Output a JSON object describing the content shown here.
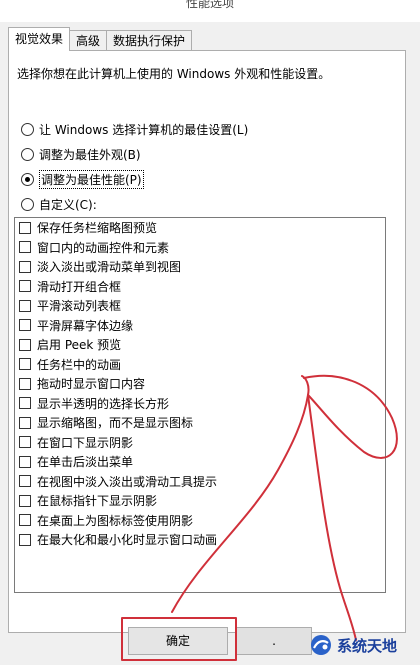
{
  "window": {
    "title": "性能选项"
  },
  "tabs": [
    {
      "label": "视觉效果",
      "active": true
    },
    {
      "label": "高级",
      "active": false
    },
    {
      "label": "数据执行保护",
      "active": false
    }
  ],
  "panel": {
    "description": "选择你想在此计算机上使用的 Windows 外观和性能设置。",
    "radios": [
      {
        "label": "让 Windows 选择计算机的最佳设置(L)",
        "checked": false
      },
      {
        "label": "调整为最佳外观(B)",
        "checked": false
      },
      {
        "label": "调整为最佳性能(P)",
        "checked": true
      },
      {
        "label": "自定义(C):",
        "checked": false
      }
    ],
    "effects": [
      "保存任务栏缩略图预览",
      "窗口内的动画控件和元素",
      "淡入淡出或滑动菜单到视图",
      "滑动打开组合框",
      "平滑滚动列表框",
      "平滑屏幕字体边缘",
      "启用 Peek 预览",
      "任务栏中的动画",
      "拖动时显示窗口内容",
      "显示半透明的选择长方形",
      "显示缩略图，而不是显示图标",
      "在窗口下显示阴影",
      "在单击后淡出菜单",
      "在视图中淡入淡出或滑动工具提示",
      "在鼠标指针下显示阴影",
      "在桌面上为图标标签使用阴影",
      "在最大化和最小化时显示窗口动画"
    ]
  },
  "buttons": {
    "ok": "确定",
    "cancel": "."
  },
  "annotation": {
    "color": "#d0303a"
  },
  "watermark": {
    "text": "系统天地"
  }
}
